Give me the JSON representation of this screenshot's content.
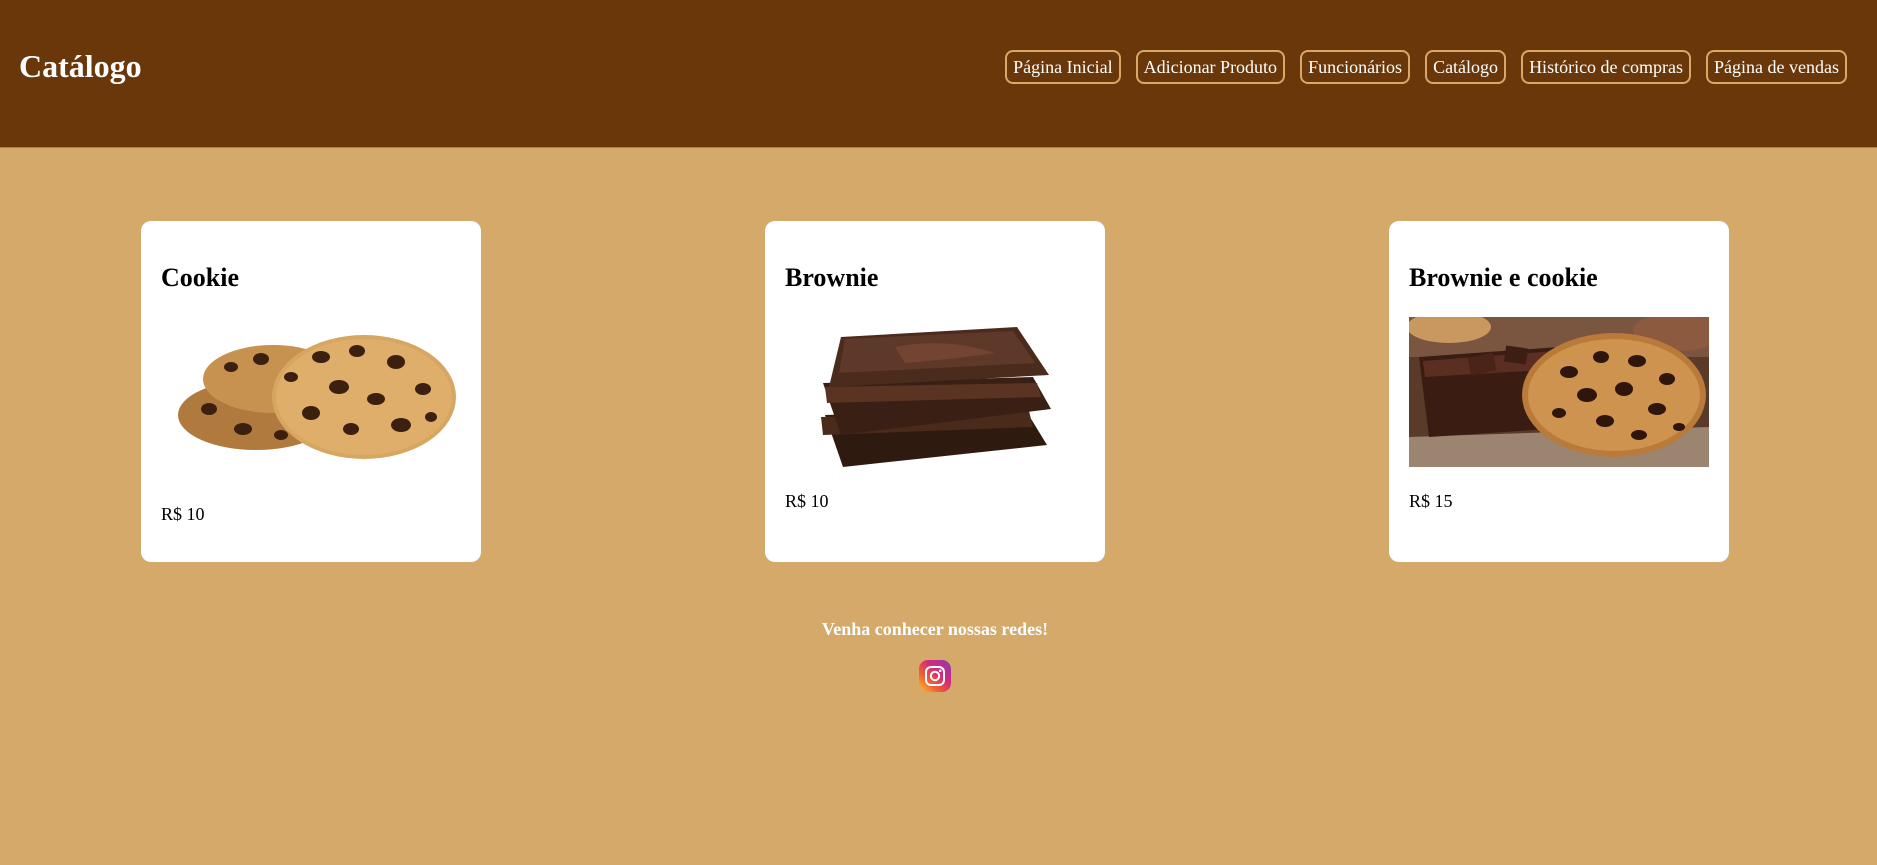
{
  "header": {
    "title": "Catálogo",
    "nav": [
      "Página Inicial",
      "Adicionar Produto",
      "Funcionários",
      "Catálogo",
      "Histórico de compras",
      "Página de vendas"
    ]
  },
  "products": [
    {
      "name": "Cookie",
      "price": "R$ 10",
      "image": "cookie-image"
    },
    {
      "name": "Brownie",
      "price": "R$ 10",
      "image": "brownie-image"
    },
    {
      "name": "Brownie e cookie",
      "price": "R$ 15",
      "image": "brownie-and-cookie-image"
    }
  ],
  "footer": {
    "text": "Venha conhecer nossas redes!",
    "social_icon": "instagram-icon"
  },
  "colors": {
    "header_bg": "#6a370a",
    "page_bg": "#d4a96a",
    "nav_border": "#d9a767",
    "card_bg": "#ffffff"
  }
}
